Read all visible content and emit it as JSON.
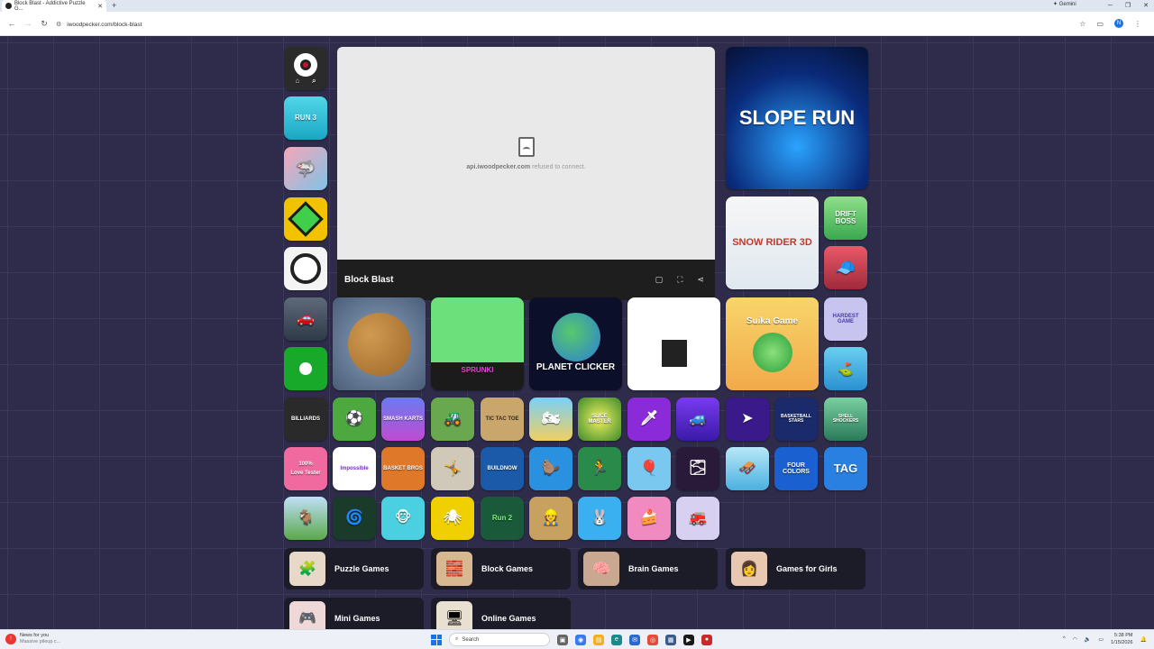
{
  "browser": {
    "tab_title": "Block Blast - Addictive Puzzle G...",
    "url": "iwoodpecker.com/block-blast",
    "gemini_label": "Gemini",
    "profile_initial": "N"
  },
  "site": {
    "logo_icons": [
      "home-icon",
      "search-icon"
    ]
  },
  "game": {
    "title": "Block Blast",
    "error_host": "api.iwoodpecker.com",
    "error_text": "refused to connect."
  },
  "tiles": {
    "run3": "RUN 3",
    "slope_run": "SLOPE RUN",
    "snow_rider": "SNOW RIDER 3D",
    "drift_boss": "DRIFT BOSS",
    "sprunki": "SPRUNKI",
    "planet_clicker": "PLANET CLICKER",
    "suika": "Suika Game",
    "hardest_game": "HARDEST GAME",
    "billiards": "BILLIARDS",
    "smash_karts": "SMASH KARTS",
    "tic_tac_toe": "TIC TAC TOE",
    "love_tester": "Love Tester",
    "love_pct": "100%",
    "impossible": "Impossible",
    "basket_bros": "BASKET BROS",
    "build_now": "BUILDNOW",
    "four_colors": "FOUR COLORS",
    "tag": "TAG",
    "run2": "Run 2",
    "basketball_stars": "BASKETBALL STARS",
    "slice_master": "SLICE MASTER",
    "shell_shockers": "SHELL SHOCKERS"
  },
  "categories": [
    {
      "label": "Puzzle Games",
      "icon": "puzzle-icon"
    },
    {
      "label": "Block Games",
      "icon": "block-icon"
    },
    {
      "label": "Brain Games",
      "icon": "brain-icon"
    },
    {
      "label": "Games for Girls",
      "icon": "girl-icon"
    },
    {
      "label": "Mini Games",
      "icon": "mini-icon"
    },
    {
      "label": "Online Games",
      "icon": "computer-icon"
    }
  ],
  "taskbar": {
    "news_title": "News for you",
    "news_sub": "Massive pileup c...",
    "search_placeholder": "Search",
    "time": "5:38 PM",
    "date": "1/15/2026"
  }
}
